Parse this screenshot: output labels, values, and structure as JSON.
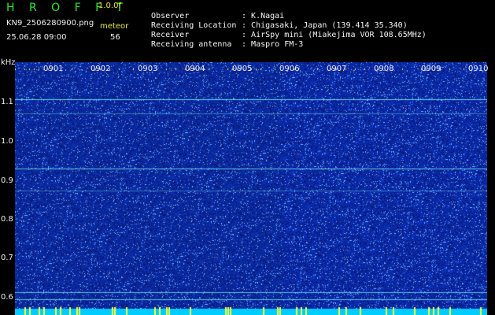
{
  "header": {
    "app_name": "H R O F F T",
    "version": "1.0.0f",
    "file_name": "KN9_2506280900.png",
    "date_time": "25.06.28 09:00",
    "meteor_label": "meteor",
    "meteor_count": "56"
  },
  "info": [
    {
      "key": "Observer",
      "value": "K.Nagai"
    },
    {
      "key": "Receiving Location",
      "value": "Chigasaki, Japan (139.414 35.340)"
    },
    {
      "key": "Receiver",
      "value": "AirSpy mini (Miakejima VOR 108.65MHz)"
    },
    {
      "key": "Receiving antenna",
      "value": "Maspro FM-3"
    }
  ],
  "axis": {
    "unit": "kHz",
    "y_ticks": [
      "1.1",
      "1.0",
      "0.9",
      "0.8",
      "0.7",
      "0.6"
    ],
    "time_labels": [
      "0901",
      "0902",
      "0903",
      "0904",
      "0905",
      "0906",
      "0907",
      "0908",
      "0909",
      "0910"
    ]
  },
  "colors": {
    "background": "#000000",
    "spectrum_base": "#0a1a8a",
    "logo": "#2ee82e",
    "accent_yellow": "#e8e84a",
    "carrier_line": "#55ddee",
    "bottom_band": "#00ccff"
  }
}
